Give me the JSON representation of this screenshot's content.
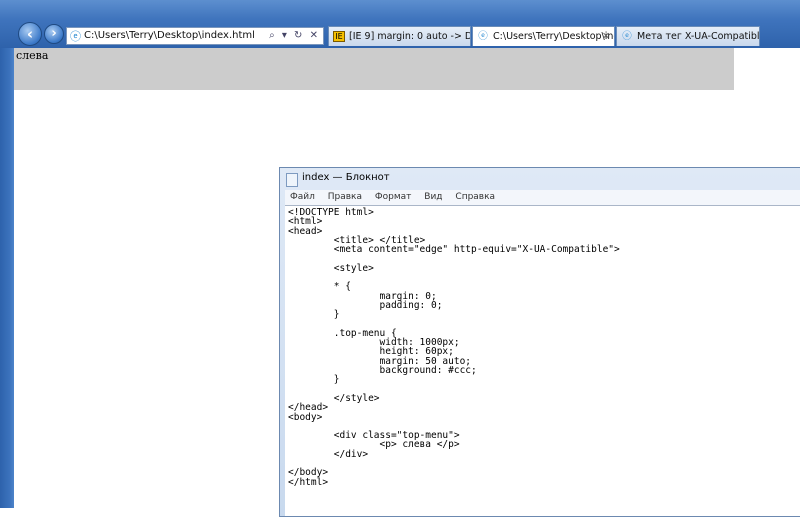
{
  "browser": {
    "address_url": "C:\\Users\\Terry\\Desktop\\index.html",
    "address_controls": "⌕ ▾ ↻ ✕",
    "tabs": [
      {
        "title": "[IE 9] margin: 0 auto -> Demiar…",
        "favicon": "ie9-badge",
        "active": false
      },
      {
        "title": "C:\\Users\\Terry\\Desktop\\ind…",
        "favicon": "ie-icon",
        "active": true
      },
      {
        "title": "Мета тег X-UA-Compatible | н…",
        "favicon": "ie-icon",
        "active": false
      }
    ],
    "tab_close": "✕"
  },
  "page": {
    "top_menu_text": "слева",
    "top_menu_bg": "#cccccc"
  },
  "notepad": {
    "title": "index — Блокнот",
    "menu": [
      "Файл",
      "Правка",
      "Формат",
      "Вид",
      "Справка"
    ],
    "content": "<!DOCTYPE html>\n<html>\n<head>\n        <title> </title>\n        <meta content=\"edge\" http-equiv=\"X-UA-Compatible\">\n\n        <style>\n\n        * {\n                margin: 0;\n                padding: 0;\n        }\n\n        .top-menu {\n                width: 1000px;\n                height: 60px;\n                margin: 50 auto;\n                background: #ccc;\n        }\n\n        </style>\n</head>\n<body>\n\n        <div class=\"top-menu\">\n                <p> слева </p>\n        </div>\n\n</body>\n</html>"
  }
}
